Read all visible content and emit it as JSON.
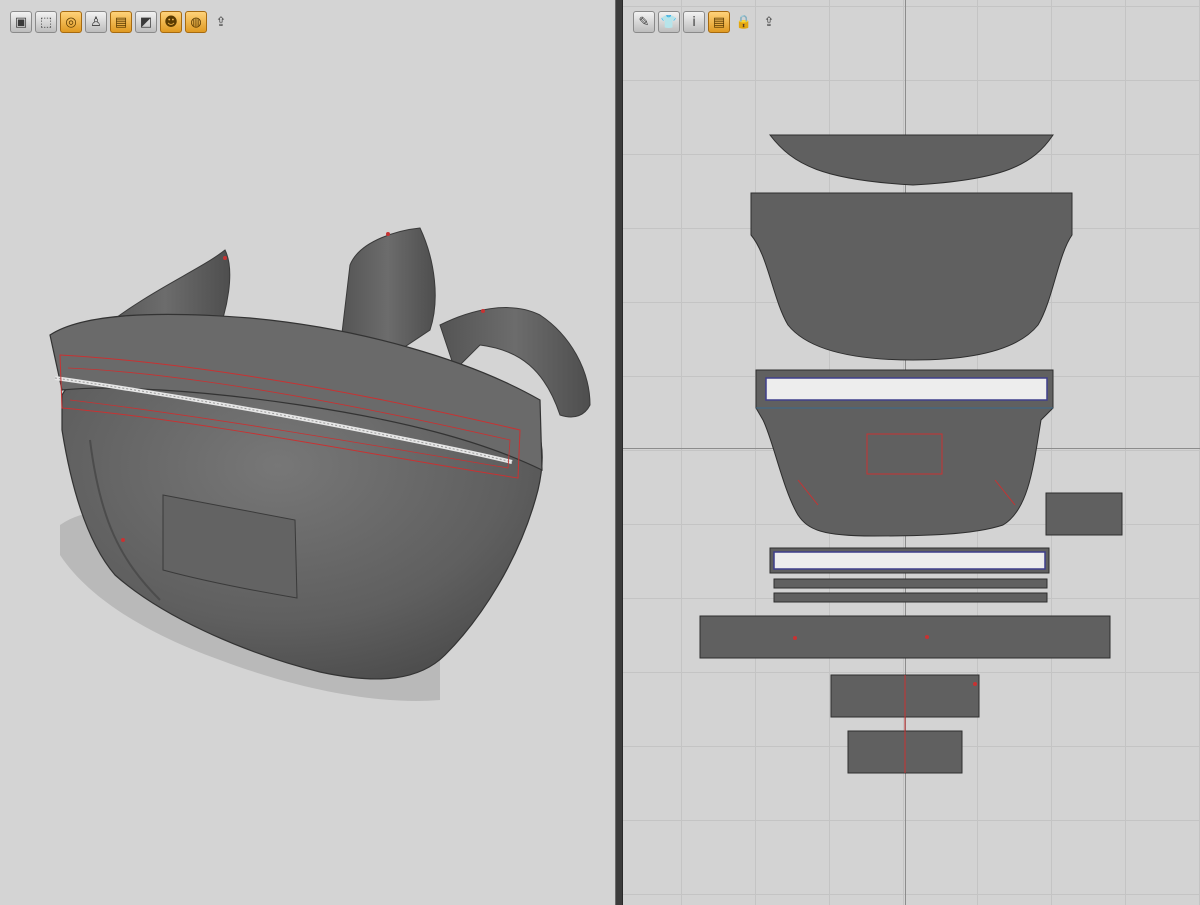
{
  "viewport_3d": {
    "toolbar": [
      {
        "icon": "cube-shaded-icon",
        "glyph": "▣",
        "style": "gray"
      },
      {
        "icon": "cube-wire-icon",
        "glyph": "⬚",
        "style": "gray"
      },
      {
        "icon": "texture-icon",
        "glyph": "◎",
        "style": "orange"
      },
      {
        "icon": "avatar-icon",
        "glyph": "♙",
        "style": "gray"
      },
      {
        "icon": "garment-icon",
        "glyph": "▤",
        "style": "orange"
      },
      {
        "icon": "pattern-icon",
        "glyph": "◩",
        "style": "gray"
      },
      {
        "icon": "body-icon",
        "glyph": "☻",
        "style": "orange"
      },
      {
        "icon": "fabric-icon",
        "glyph": "◍",
        "style": "orange"
      },
      {
        "icon": "export-icon",
        "glyph": "⇪",
        "style": "flat"
      }
    ]
  },
  "viewport_2d": {
    "toolbar": [
      {
        "icon": "pen-icon",
        "glyph": "✎",
        "style": "gray"
      },
      {
        "icon": "shirt-icon",
        "glyph": "👕",
        "style": "gray"
      },
      {
        "icon": "info-icon",
        "glyph": "i",
        "style": "gray"
      },
      {
        "icon": "pattern-select-icon",
        "glyph": "▤",
        "style": "orange"
      },
      {
        "icon": "lock-icon",
        "glyph": "🔒",
        "style": "flat"
      },
      {
        "icon": "export-icon",
        "glyph": "⇪",
        "style": "flat"
      }
    ]
  },
  "colors": {
    "fabric": "#5e5e5e",
    "fabric_outline": "#2e2e2e",
    "seam": "#c83232",
    "background": "#d4d4d4"
  }
}
